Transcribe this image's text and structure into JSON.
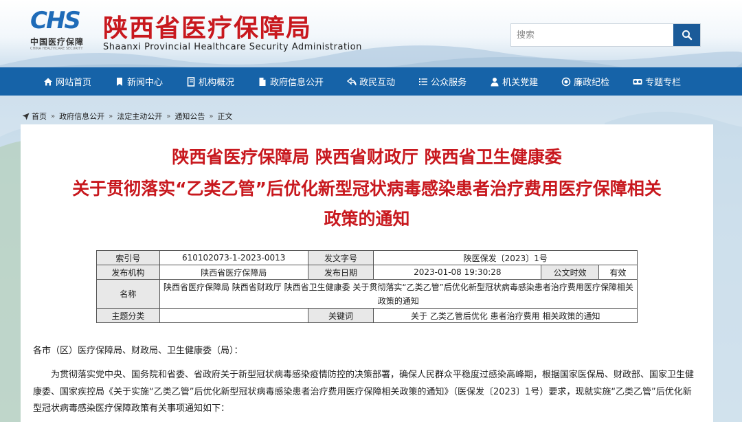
{
  "header": {
    "logo_mark": "CHS",
    "logo_cn": "中国医疗保障",
    "logo_en": "CHINA HEALTHCARE SECURITY",
    "title": "陕西省医疗保障局",
    "subtitle": "Shaanxi Provincial Healthcare Security Administration"
  },
  "search": {
    "placeholder": "搜索",
    "icon": "search-icon"
  },
  "nav": {
    "items": [
      {
        "label": "网站首页",
        "icon": "home-icon"
      },
      {
        "label": "新闻中心",
        "icon": "bookmark-icon"
      },
      {
        "label": "机构概况",
        "icon": "book-icon"
      },
      {
        "label": "政府信息公开",
        "icon": "file-icon"
      },
      {
        "label": "政民互动",
        "icon": "reply-icon"
      },
      {
        "label": "公众服务",
        "icon": "list-icon"
      },
      {
        "label": "机关党建",
        "icon": "user-icon"
      },
      {
        "label": "廉政纪检",
        "icon": "target-icon"
      },
      {
        "label": "专题专栏",
        "icon": "binoculars-icon"
      }
    ]
  },
  "breadcrumb": [
    "首页",
    "政府信息公开",
    "法定主动公开",
    "通知公告",
    "正文"
  ],
  "article": {
    "title_line1": "陕西省医疗保障局 陕西省财政厅 陕西省卫生健康委",
    "title_line2": "关于贯彻落实“乙类乙管”后优化新型冠状病毒感染患者治疗费用医疗保障相关",
    "title_line3": "政策的通知",
    "meta": {
      "index_label": "索引号",
      "index_value": "610102073-1-2023-0013",
      "doc_no_label": "发文字号",
      "doc_no_value": "陕医保发〔2023〕1号",
      "issuer_label": "发布机构",
      "issuer_value": "陕西省医疗保障局",
      "date_label": "发布日期",
      "date_value": "2023-01-08 19:30:28",
      "validity_label": "公文时效",
      "validity_value": "有效",
      "name_label": "名称",
      "name_value": "陕西省医疗保障局 陕西省财政厅 陕西省卫生健康委 关于贯彻落实“乙类乙管”后优化新型冠状病毒感染患者治疗费用医疗保障相关政策的通知",
      "topic_label": "主题分类",
      "topic_value": "",
      "keywords_label": "关键词",
      "keywords_value": "关于 乙类乙管后优化 患者治疗费用 相关政策的通知"
    },
    "salutation": "各市（区）医疗保障局、财政局、卫生健康委（局）：",
    "paragraph1": "为贯彻落实党中央、国务院和省委、省政府关于新型冠状病毒感染疫情防控的决策部署，确保人民群众平稳度过感染高峰期，根据国家医保局、财政部、国家卫生健康委、国家疾控局《关于实施“乙类乙管”后优化新型冠状病毒感染患者治疗费用医疗保障相关政策的通知》（医保发〔2023〕1号）要求，现就实施“乙类乙管”后优化新型冠状病毒感染医疗保障政策有关事项通知如下："
  },
  "colors": {
    "brand_red": "#c8181e",
    "nav_blue": "#1663a8",
    "logo_blue": "#1e6bb8",
    "search_button": "#1b5b99"
  }
}
